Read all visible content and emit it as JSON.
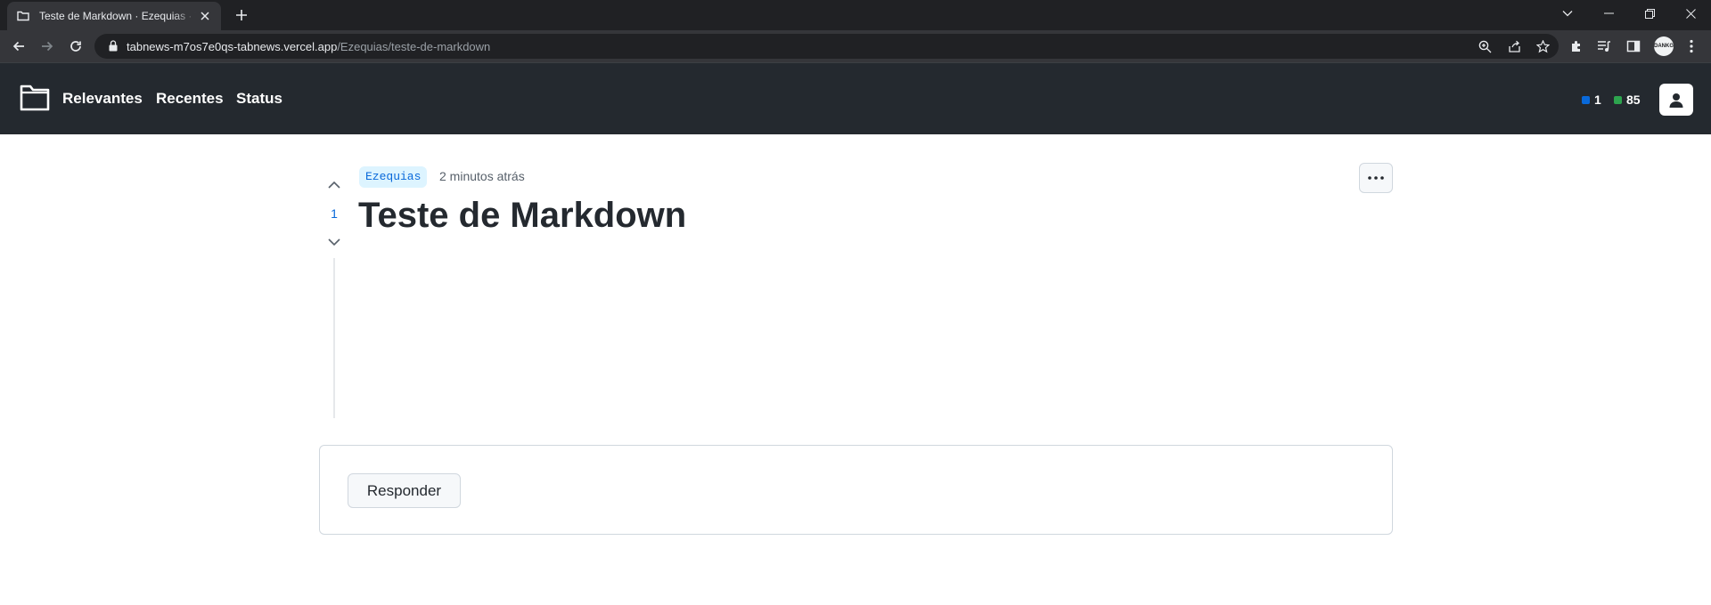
{
  "browser": {
    "tab_title": "Teste de Markdown · Ezequias · TabNews",
    "url_host": "tabnews-m7os7e0qs-tabnews.vercel.app",
    "url_path": "/Ezequias/teste-de-markdown",
    "profile_label": "DANKG"
  },
  "header": {
    "nav": [
      "Relevantes",
      "Recentes",
      "Status"
    ],
    "stat_blue": "1",
    "stat_green": "85",
    "colors": {
      "background": "#24292f",
      "blue": "#0969da",
      "green": "#2da44e"
    }
  },
  "post": {
    "author": "Ezequias",
    "time": "2 minutos atrás",
    "title": "Teste de Markdown",
    "votes": "1"
  },
  "reply": {
    "button_label": "Responder"
  }
}
